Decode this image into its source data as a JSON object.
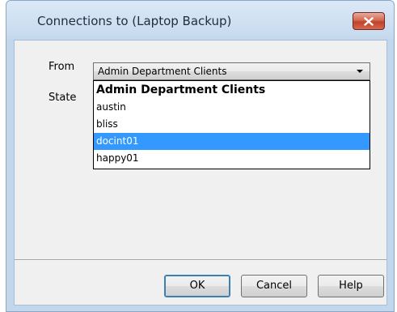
{
  "window": {
    "title": "Connections to (Laptop Backup)"
  },
  "form": {
    "from_label": "From",
    "state_label": "State",
    "from_select": {
      "selected_value": "Admin Department Clients",
      "options": [
        {
          "label": "Admin Department Clients",
          "kind": "header"
        },
        {
          "label": "austin"
        },
        {
          "label": "bliss"
        },
        {
          "label": "docint01",
          "highlighted": true
        },
        {
          "label": "happy01"
        }
      ]
    }
  },
  "buttons": {
    "ok": "OK",
    "cancel": "Cancel",
    "help": "Help"
  },
  "colors": {
    "highlight": "#3399ff",
    "close_button": "#c1432c"
  }
}
